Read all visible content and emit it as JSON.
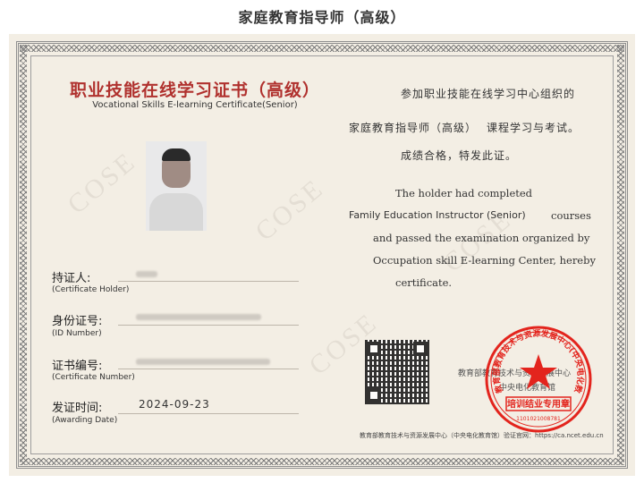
{
  "page": {
    "title": "家庭教育指导师（高级）"
  },
  "certificate": {
    "title_cn": "职业技能在线学习证书（高级）",
    "title_en": "Vocational Skills E-learning Certificate(Senior)",
    "watermark": "COSE",
    "fields": {
      "holder": {
        "label": "持证人:",
        "label_en": "(Certificate Holder)"
      },
      "id_number": {
        "label": "身份证号:",
        "label_en": "(ID Number)"
      },
      "cert_number": {
        "label": "证书编号:",
        "label_en": "(Certificate Number)"
      },
      "date": {
        "label": "发证时间:",
        "label_en": "(Awarding Date)",
        "value": "2024-09-23"
      }
    },
    "body_cn": {
      "line1": "参加职业技能在线学习中心组织的",
      "course": "家庭教育指导师（高级）",
      "line2_suffix": "课程学习与考试。",
      "line3": "成绩合格，特发此证。"
    },
    "body_en": {
      "line1": "The holder had completed",
      "course": "Family Education Instructor (Senior)",
      "line2_suffix": "courses",
      "line3": "and passed the examination organized by",
      "line4": "Occupation skill E-learning Center, hereby",
      "line5": "certificate."
    },
    "seal": {
      "issuer_text": "教育部教育技术与资源发展中心",
      "sub_text": "中央电化教育馆",
      "ring_text": "教育部教育技术与资源发展中心(中央电化教育馆)",
      "band_text": "培训结业专用章",
      "number": "1101021008781"
    },
    "footer": "教育部教育技术与资源发展中心（中央电化教育馆）验证官网：https://ca.ncet.edu.cn"
  },
  "colors": {
    "accent_red": "#b0312e",
    "seal_red": "#e3241d",
    "paper": "#f3eee4"
  },
  "icons": {
    "photo": "portrait-photo",
    "qr": "qr-code-icon",
    "seal": "official-seal-icon"
  }
}
